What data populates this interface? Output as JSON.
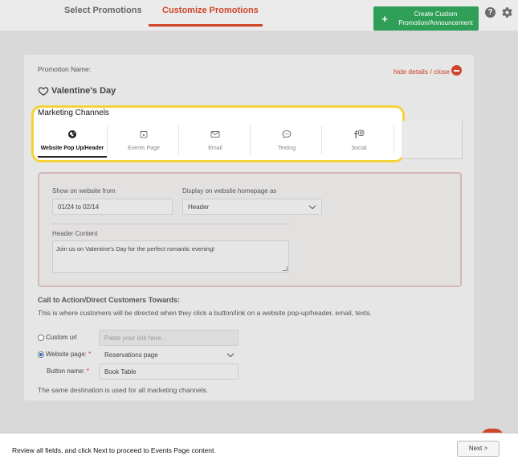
{
  "header": {
    "tabs": [
      {
        "label": "Select Promotions"
      },
      {
        "label": "Customize Promotions"
      }
    ],
    "create_button": {
      "line1": "Create Custom",
      "line2": "Promotion/Announcement"
    },
    "help_label": "?"
  },
  "promotion": {
    "name_label": "Promotion Name:",
    "name": "Valentine's Day",
    "hide_details": "hide details / close"
  },
  "marketing": {
    "title": "Marketing Channels",
    "channels": [
      {
        "label": "Website Pop Up/Header",
        "icon": "globe-icon",
        "active": true
      },
      {
        "label": "Events Page",
        "icon": "calendar-icon"
      },
      {
        "label": "Email",
        "icon": "envelope-icon"
      },
      {
        "label": "Texting",
        "icon": "chat-bubble-icon"
      },
      {
        "label": "Social",
        "icon": "facebook-instagram-icon"
      }
    ]
  },
  "website": {
    "show_label": "Show on website from",
    "show_value": "01/24 to 02/14",
    "display_label": "Display on website homepage as",
    "display_value": "Header",
    "header_content_label": "Header Content",
    "header_content_value": "Join us on Valentine's Day for the perfect romantic evening!"
  },
  "cta": {
    "title": "Call to Action/Direct Customers Towards:",
    "description": "This is where customers will be directed when they click a button/link on a website pop-up/header, email, texts.",
    "custom_url_label": "Custom url",
    "custom_url_placeholder": "Paste your link here...",
    "website_page_label": "Website page:",
    "website_page_value": "Reservations page",
    "button_name_label": "Button name:",
    "button_name_value": "Book Table",
    "required_mark": "*",
    "note": "The same destination is used for all marketing channels."
  },
  "footer": {
    "text": "Review all fields, and click Next to proceed to Events Page content.",
    "next_label": "Next >"
  },
  "colors": {
    "accent": "#d0452a",
    "create_green": "#2f9e57",
    "highlight": "#f6d23a"
  }
}
